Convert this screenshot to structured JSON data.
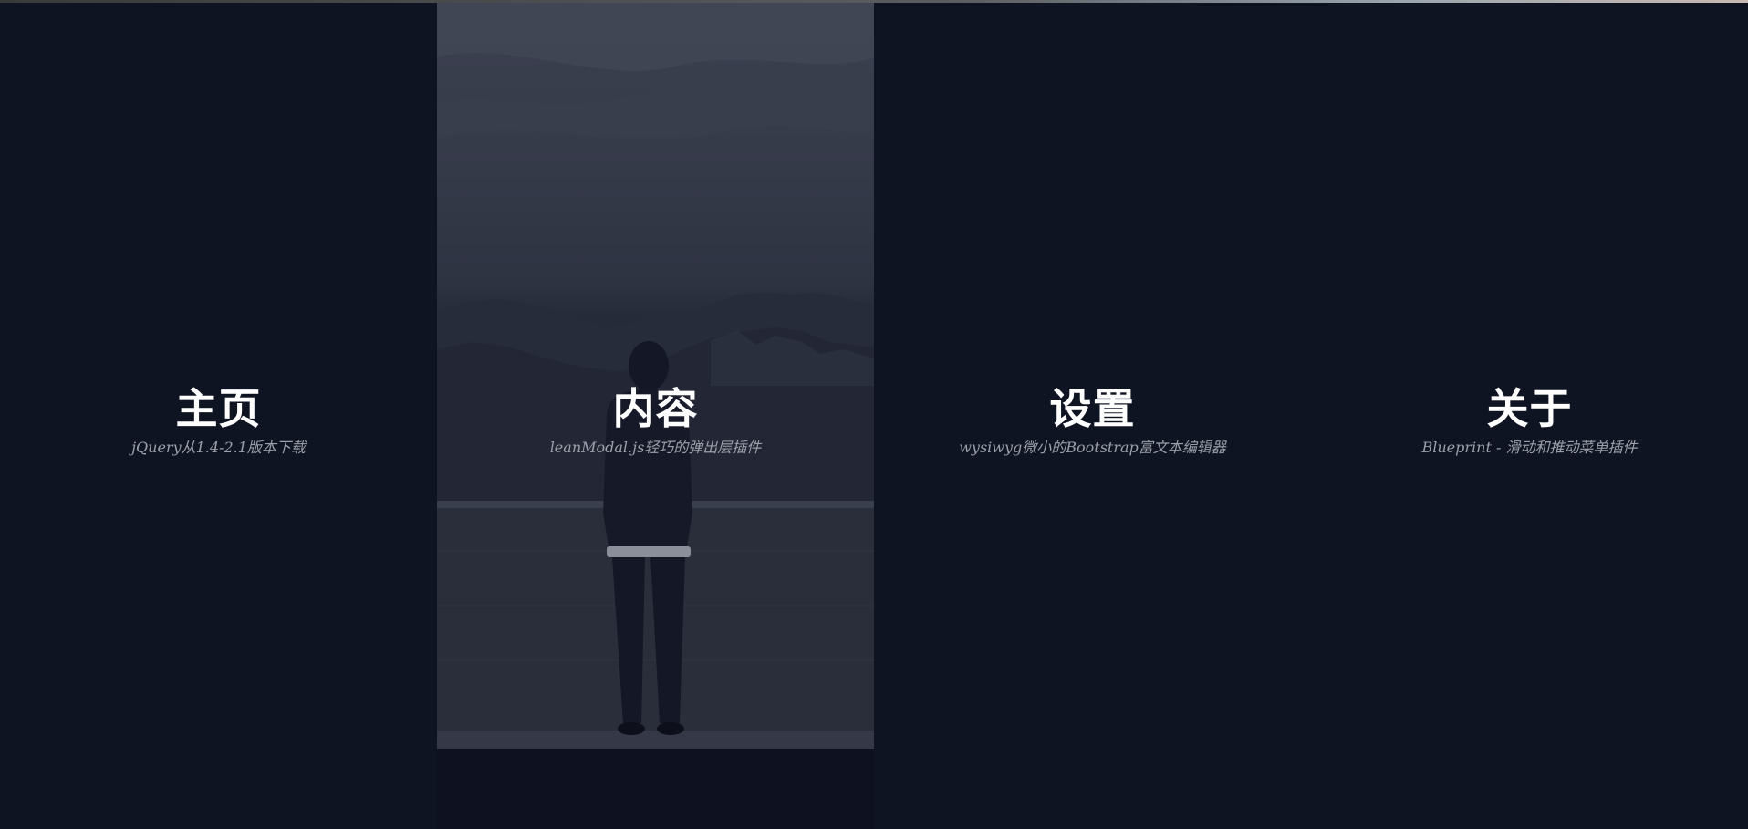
{
  "menu": {
    "items": [
      {
        "title": "主页",
        "subtitle": "jQuery从1.4-2.1版本下载"
      },
      {
        "title": "内容",
        "subtitle": "leanModal.js轻巧的弹出层插件"
      },
      {
        "title": "设置",
        "subtitle": "wysiwyg微小的Bootstrap富文本编辑器"
      },
      {
        "title": "关于",
        "subtitle": "Blueprint - 滑动和推动菜单插件"
      }
    ]
  },
  "colors": {
    "background": "#0f1422",
    "title": "#ffffff",
    "subtitle": "#9aa0aa"
  }
}
